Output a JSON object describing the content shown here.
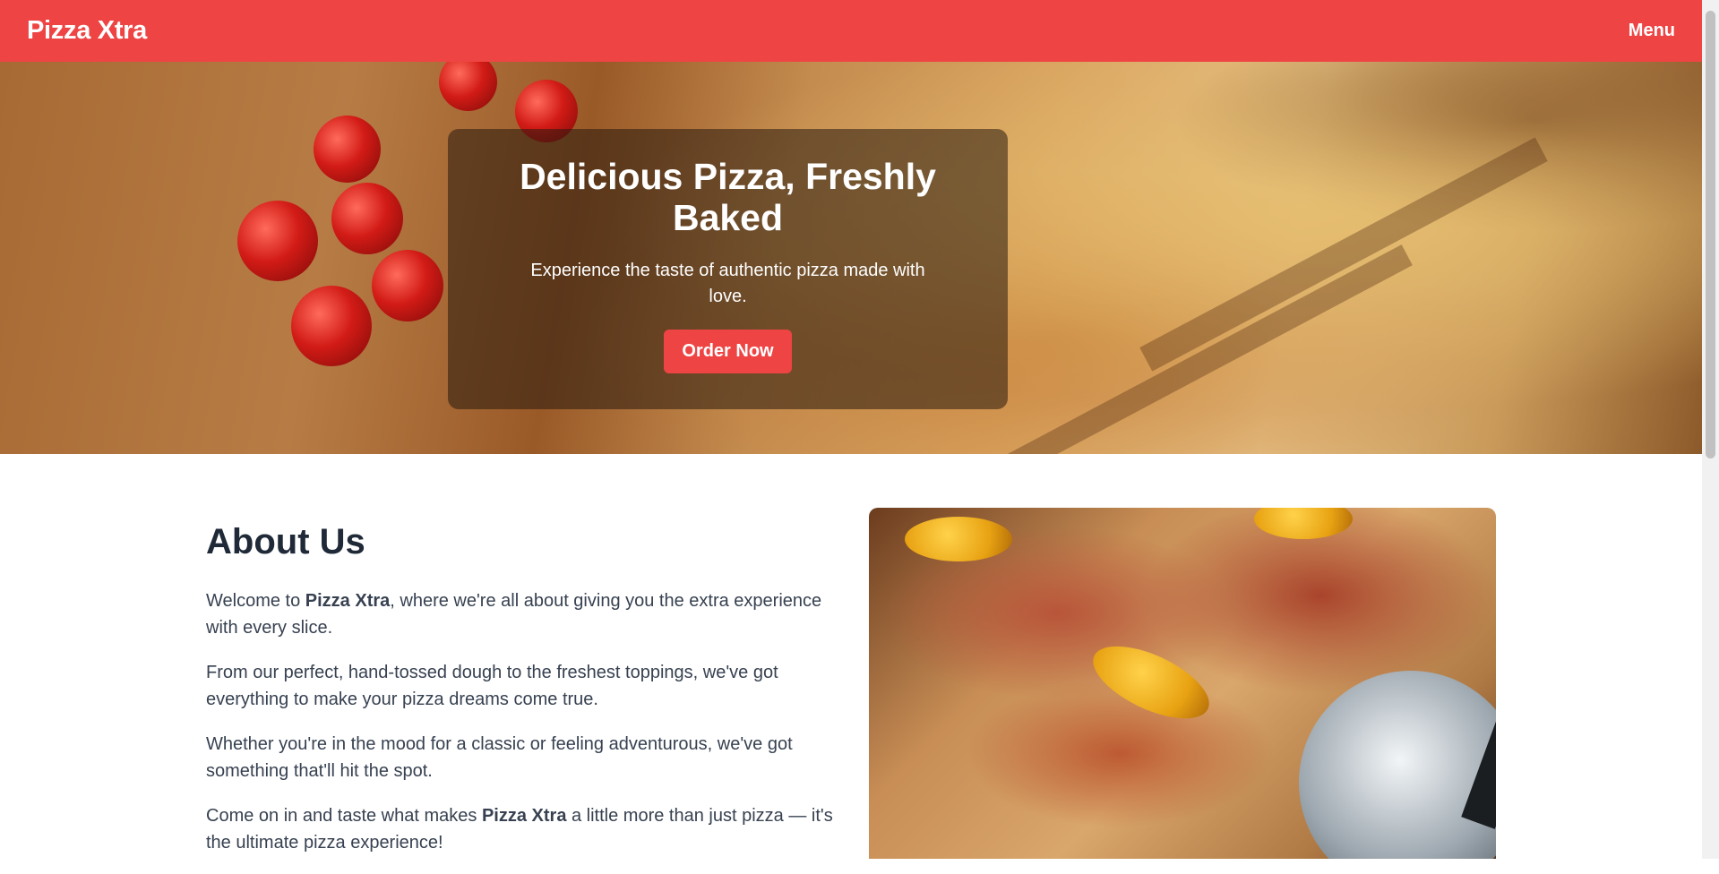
{
  "nav": {
    "brand": "Pizza Xtra",
    "menu_label": "Menu"
  },
  "hero": {
    "title": "Delicious Pizza, Freshly Baked",
    "subtitle": "Experience the taste of authentic pizza made with love.",
    "cta_label": "Order Now"
  },
  "about": {
    "title": "About Us",
    "p1_before": "Welcome to ",
    "p1_brand": "Pizza Xtra",
    "p1_after": ", where we're all about giving you the extra experience with every slice.",
    "p2": "From our perfect, hand-tossed dough to the freshest toppings, we've got everything to make your pizza dreams come true.",
    "p3": "Whether you're in the mood for a classic or feeling adventurous, we've got something that'll hit the spot.",
    "p4_before": "Come on in and taste what makes ",
    "p4_brand": "Pizza Xtra",
    "p4_after": " a little more than just pizza — it's the ultimate pizza experience!"
  },
  "colors": {
    "accent": "#ef4444",
    "heading": "#1f2937",
    "body_text": "#374151"
  }
}
